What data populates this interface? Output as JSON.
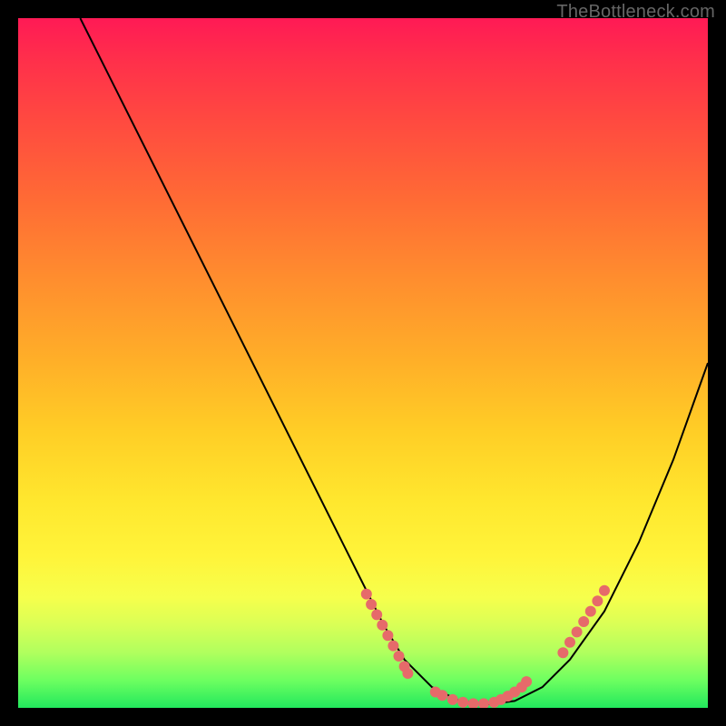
{
  "watermark": "TheBottleneck.com",
  "chart_data": {
    "type": "line",
    "title": "",
    "xlabel": "",
    "ylabel": "",
    "xlim": [
      0,
      100
    ],
    "ylim": [
      0,
      100
    ],
    "series": [
      {
        "name": "curve",
        "x": [
          9,
          15,
          20,
          25,
          30,
          35,
          40,
          45,
          50,
          53,
          56,
          60,
          64,
          68,
          72,
          76,
          80,
          85,
          90,
          95,
          100
        ],
        "y": [
          100,
          88,
          78,
          68,
          58,
          48,
          38,
          28,
          18,
          12,
          7,
          3,
          1,
          0.5,
          1,
          3,
          7,
          14,
          24,
          36,
          50
        ]
      },
      {
        "name": "highlight-left",
        "x": [
          50.5,
          51.2,
          52.0,
          52.8,
          53.6,
          54.4,
          55.2,
          56.0,
          56.5
        ],
        "y": [
          16.5,
          15.0,
          13.5,
          12.0,
          10.5,
          9.0,
          7.5,
          6.0,
          5.0
        ]
      },
      {
        "name": "highlight-bottom",
        "x": [
          60.5,
          61.5,
          63.0,
          64.5,
          66.0,
          67.5,
          69.0,
          70.0,
          71.0,
          72.0,
          73.0,
          73.7
        ],
        "y": [
          2.3,
          1.8,
          1.2,
          0.8,
          0.6,
          0.6,
          0.8,
          1.2,
          1.7,
          2.3,
          3.0,
          3.8
        ]
      },
      {
        "name": "highlight-right",
        "x": [
          79.0,
          80.0,
          81.0,
          82.0,
          83.0,
          84.0,
          85.0
        ],
        "y": [
          8.0,
          9.5,
          11.0,
          12.5,
          14.0,
          15.5,
          17.0
        ]
      }
    ],
    "colors": {
      "curve": "#000000",
      "highlight": "#e66a6a"
    }
  }
}
